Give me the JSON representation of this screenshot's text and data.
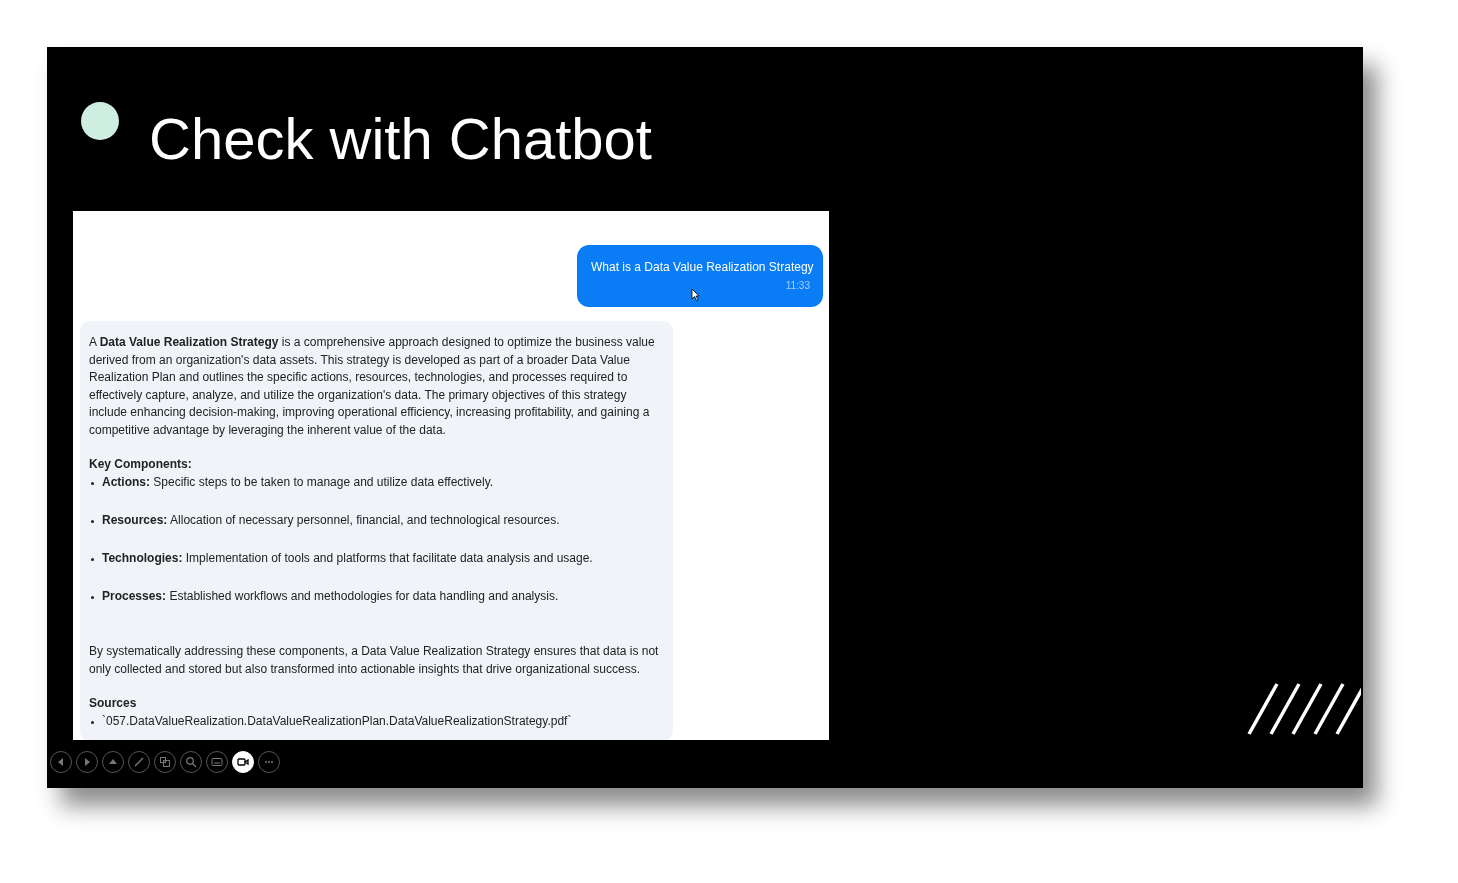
{
  "slide": {
    "title": "Check with Chatbot"
  },
  "chat": {
    "messages": [
      {
        "kind": "user",
        "text": "What is a Data Value Realization Strategy",
        "time": "11:33"
      },
      {
        "kind": "bot",
        "blocks": [
          {
            "kind": "paragraph",
            "text": "A **Data Value Realization Strategy** is a comprehensive approach designed to optimize the business value derived from an organization's data assets. This strategy is developed as part of a broader Data Value Realization Plan and outlines the specific actions, resources, technologies, and processes required to effectively capture, analyze, and utilize the organization's data. The primary objectives of this strategy include enhancing decision-making, improving operational efficiency, increasing profitability, and gaining a competitive advantage by leveraging the inherent value of the data."
          },
          {
            "kind": "heading",
            "text": "Key Components:"
          },
          {
            "kind": "bullet",
            "text": "**Actions:** Specific steps to be taken to manage and utilize data effectively."
          },
          {
            "kind": "bullet",
            "text": "**Resources:** Allocation of necessary personnel, financial, and technological resources."
          },
          {
            "kind": "bullet",
            "text": "**Technologies:** Implementation of tools and platforms that facilitate data analysis and usage."
          },
          {
            "kind": "bullet",
            "text": "**Processes:** Established workflows and methodologies for data handling and analysis."
          },
          {
            "kind": "paragraph",
            "text": "By systematically addressing these components, a Data Value Realization Strategy ensures that data is not only collected and stored but also transformed into actionable insights that drive organizational success."
          },
          {
            "kind": "heading",
            "text": "Sources"
          },
          {
            "kind": "source",
            "text": "`057.DataValueRealization.DataValueRealizationPlan.DataValueRealizationStrategy.pdf`"
          }
        ]
      }
    ]
  },
  "toolbar": [
    {
      "kind": "previous",
      "on": false
    },
    {
      "kind": "next",
      "on": false
    },
    {
      "kind": "up",
      "on": false
    },
    {
      "kind": "pen",
      "on": false
    },
    {
      "kind": "slides",
      "on": false
    },
    {
      "kind": "zoom",
      "on": false
    },
    {
      "kind": "subtitles",
      "on": false
    },
    {
      "kind": "camera",
      "on": true
    },
    {
      "kind": "more",
      "on": false
    }
  ]
}
